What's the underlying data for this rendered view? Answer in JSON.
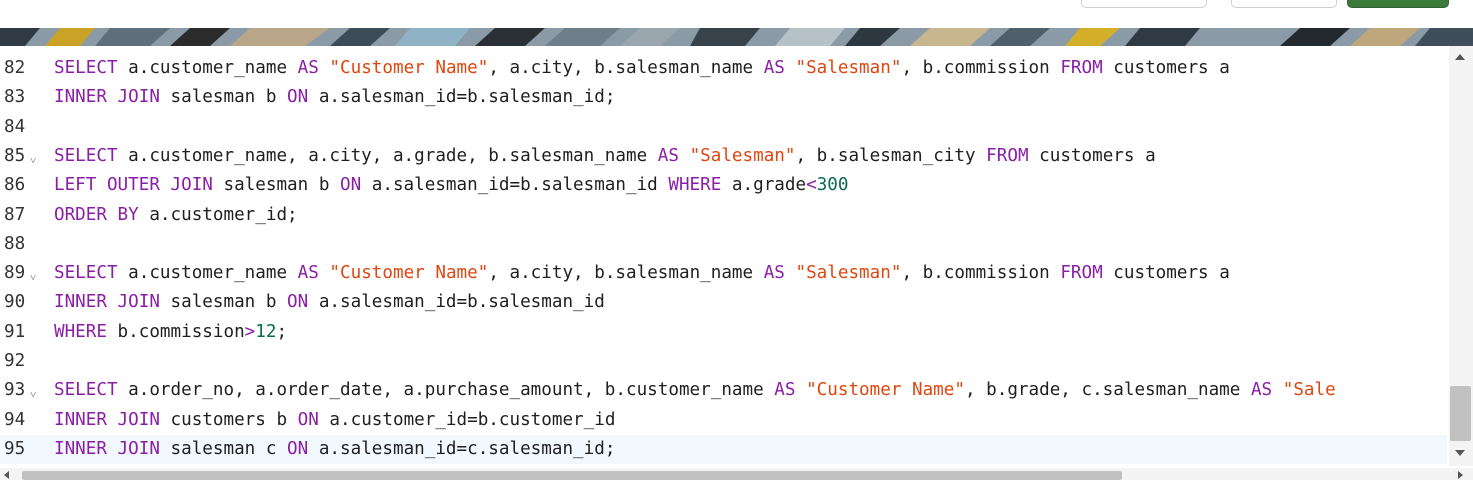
{
  "colors": {
    "keyword": "#8a1ea6",
    "string": "#e0460f",
    "number": "#0b6b4f",
    "text": "#1f1f1f",
    "active_line": "#f1f8fe"
  },
  "lines": [
    {
      "number": "82",
      "fold": false,
      "active": false,
      "tokens": [
        [
          "kw",
          "SELECT"
        ],
        [
          "t",
          " a.customer_name "
        ],
        [
          "kw",
          "AS"
        ],
        [
          "t",
          " "
        ],
        [
          "str",
          "\"Customer Name\""
        ],
        [
          "t",
          ", a.city, b.salesman_name "
        ],
        [
          "kw",
          "AS"
        ],
        [
          "t",
          " "
        ],
        [
          "str",
          "\"Salesman\""
        ],
        [
          "t",
          ", b.commission "
        ],
        [
          "kw",
          "FROM"
        ],
        [
          "t",
          " customers a"
        ]
      ]
    },
    {
      "number": "83",
      "fold": false,
      "active": false,
      "tokens": [
        [
          "kw",
          "INNER JOIN"
        ],
        [
          "t",
          " salesman b "
        ],
        [
          "kw",
          "ON"
        ],
        [
          "t",
          " a.salesman_id=b.salesman_id;"
        ]
      ]
    },
    {
      "number": "84",
      "fold": false,
      "active": false,
      "tokens": []
    },
    {
      "number": "85",
      "fold": true,
      "active": false,
      "tokens": [
        [
          "kw",
          "SELECT"
        ],
        [
          "t",
          " a.customer_name, a.city, a.grade, b.salesman_name "
        ],
        [
          "kw",
          "AS"
        ],
        [
          "t",
          " "
        ],
        [
          "str",
          "\"Salesman\""
        ],
        [
          "t",
          ", b.salesman_city "
        ],
        [
          "kw",
          "FROM"
        ],
        [
          "t",
          " customers a"
        ]
      ]
    },
    {
      "number": "86",
      "fold": false,
      "active": false,
      "tokens": [
        [
          "kw",
          "LEFT OUTER JOIN"
        ],
        [
          "t",
          " salesman b "
        ],
        [
          "kw",
          "ON"
        ],
        [
          "t",
          " a.salesman_id=b.salesman_id "
        ],
        [
          "kw",
          "WHERE"
        ],
        [
          "t",
          " a.grade"
        ],
        [
          "kw",
          "<"
        ],
        [
          "num",
          "300"
        ]
      ]
    },
    {
      "number": "87",
      "fold": false,
      "active": false,
      "tokens": [
        [
          "kw",
          "ORDER BY"
        ],
        [
          "t",
          " a.customer_id;"
        ]
      ]
    },
    {
      "number": "88",
      "fold": false,
      "active": false,
      "tokens": []
    },
    {
      "number": "89",
      "fold": true,
      "active": false,
      "tokens": [
        [
          "kw",
          "SELECT"
        ],
        [
          "t",
          " a.customer_name "
        ],
        [
          "kw",
          "AS"
        ],
        [
          "t",
          " "
        ],
        [
          "str",
          "\"Customer Name\""
        ],
        [
          "t",
          ", a.city, b.salesman_name "
        ],
        [
          "kw",
          "AS"
        ],
        [
          "t",
          " "
        ],
        [
          "str",
          "\"Salesman\""
        ],
        [
          "t",
          ", b.commission "
        ],
        [
          "kw",
          "FROM"
        ],
        [
          "t",
          " customers a"
        ]
      ]
    },
    {
      "number": "90",
      "fold": false,
      "active": false,
      "tokens": [
        [
          "kw",
          "INNER JOIN"
        ],
        [
          "t",
          " salesman b "
        ],
        [
          "kw",
          "ON"
        ],
        [
          "t",
          " a.salesman_id=b.salesman_id"
        ]
      ]
    },
    {
      "number": "91",
      "fold": false,
      "active": false,
      "tokens": [
        [
          "kw",
          "WHERE"
        ],
        [
          "t",
          " b.commission"
        ],
        [
          "kw",
          ">"
        ],
        [
          "num",
          "12"
        ],
        [
          "t",
          ";"
        ]
      ]
    },
    {
      "number": "92",
      "fold": false,
      "active": false,
      "tokens": []
    },
    {
      "number": "93",
      "fold": true,
      "active": false,
      "tokens": [
        [
          "kw",
          "SELECT"
        ],
        [
          "t",
          " a.order_no, a.order_date, a.purchase_amount, b.customer_name "
        ],
        [
          "kw",
          "AS"
        ],
        [
          "t",
          " "
        ],
        [
          "str",
          "\"Customer Name\""
        ],
        [
          "t",
          ", b.grade, c.salesman_name "
        ],
        [
          "kw",
          "AS"
        ],
        [
          "t",
          " "
        ],
        [
          "str",
          "\"Sale"
        ]
      ]
    },
    {
      "number": "94",
      "fold": false,
      "active": false,
      "tokens": [
        [
          "kw",
          "INNER JOIN"
        ],
        [
          "t",
          " customers b "
        ],
        [
          "kw",
          "ON"
        ],
        [
          "t",
          " a.customer_id=b.customer_id"
        ]
      ]
    },
    {
      "number": "95",
      "fold": false,
      "active": true,
      "tokens": [
        [
          "kw",
          "INNER JOIN"
        ],
        [
          "t",
          " salesman c "
        ],
        [
          "kw",
          "ON"
        ],
        [
          "t",
          " a.salesman_id=c.salesman_id;"
        ]
      ]
    }
  ]
}
